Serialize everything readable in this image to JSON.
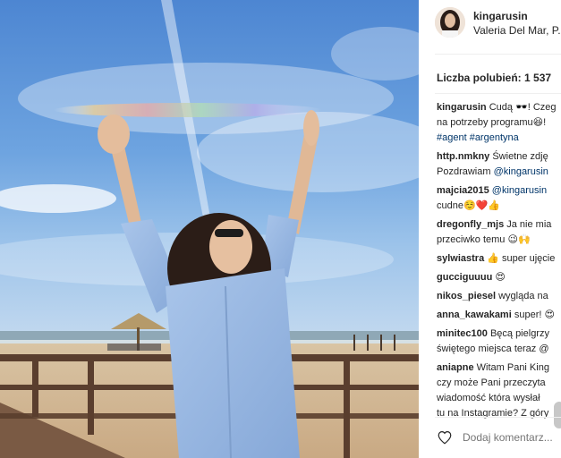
{
  "post": {
    "username": "kingarusin",
    "location": "Valeria Del Mar, P...",
    "likes_label": "Liczba polubień:",
    "likes_count": "1 537",
    "add_comment_placeholder": "Dodaj komentarz..."
  },
  "caption": {
    "user": "kingarusin",
    "line1": "Cudą 🕶️! Czeg",
    "line2": "na potrzeby programu😆!",
    "hashtags": "#agent #argentyna"
  },
  "comments": [
    {
      "user": "http.nmkny",
      "line1": "Świetne zdję",
      "line2": "Pozdrawiam",
      "mention": "@kingarusin"
    },
    {
      "user": "majcia2015",
      "mention": "@kingarusin",
      "line2": "cudne☺️❤️👍"
    },
    {
      "user": "dregonfly_mjs",
      "line1": "Ja nie mia",
      "line2": "przeciwko temu 😉🙌"
    },
    {
      "user": "sylwiastra",
      "line1": "👍 super ujęcie"
    },
    {
      "user": "gucciguuuu",
      "line1": "😍"
    },
    {
      "user": "nikos_piesel",
      "line1": "wygląda na"
    },
    {
      "user": "anna_kawakami",
      "line1": "super! 😍"
    },
    {
      "user": "minitec100",
      "line1": "Bęcą pielgrzy",
      "line2": "świętego miejsca teraz @"
    },
    {
      "user": "aniapne",
      "line1": "Witam Pani King",
      "line2": "czy może Pani przeczyta",
      "line3": "wiadomość która wysłał",
      "line4": "tu na Instagramie? Z góry"
    }
  ],
  "icons": {
    "like": "heart-icon",
    "avatar": "avatar"
  },
  "colors": {
    "link": "#003569",
    "placeholder": "#999999",
    "text": "#262626"
  }
}
